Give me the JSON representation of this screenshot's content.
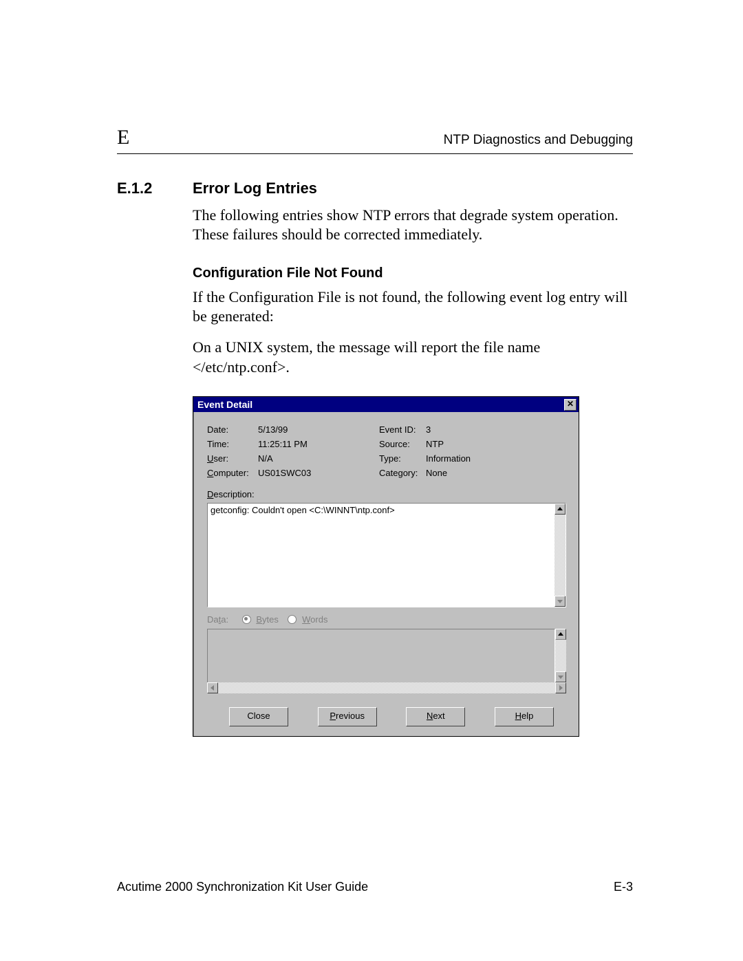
{
  "header": {
    "appendix": "E",
    "title_right": "NTP Diagnostics and Debugging"
  },
  "section": {
    "number": "E.1.2",
    "title": "Error Log Entries",
    "intro": "The following entries show NTP errors that degrade system operation. These failures should be corrected immediately."
  },
  "subsection": {
    "title": "Configuration File Not Found",
    "para1": "If the Configuration File is not found, the following event log entry will be generated:",
    "para2": "On a UNIX system, the message will report the file name </etc/ntp.conf>."
  },
  "dialog": {
    "title": "Event Detail",
    "fields": {
      "date_label": "Date:",
      "date": "5/13/99",
      "time_label": "Time:",
      "time": "11:25:11 PM",
      "user_label_pre": "U",
      "user_label_post": "ser:",
      "user": "N/A",
      "computer_label_pre": "C",
      "computer_label_post": "omputer:",
      "computer": "US01SWC03",
      "eventid_label": "Event ID:",
      "eventid": "3",
      "source_label": "Source:",
      "source": "NTP",
      "type_label": "Type:",
      "type": "Information",
      "category_label": "Category:",
      "category": "None"
    },
    "description_label_pre": "D",
    "description_label_post": "escription:",
    "description_text": "getconfig: Couldn't open <C:\\WINNT\\ntp.conf>",
    "data_label_pre": "Da",
    "data_label_mid": "t",
    "data_label_post": "a:",
    "bytes_pre": "B",
    "bytes_post": "ytes",
    "words_pre": "W",
    "words_post": "ords",
    "buttons": {
      "close": "Close",
      "previous_pre": "P",
      "previous_post": "revious",
      "next_pre": "N",
      "next_post": "ext",
      "help_pre": "H",
      "help_post": "elp"
    }
  },
  "footer": {
    "left": "Acutime 2000 Synchronization Kit User Guide",
    "right": "E-3"
  }
}
